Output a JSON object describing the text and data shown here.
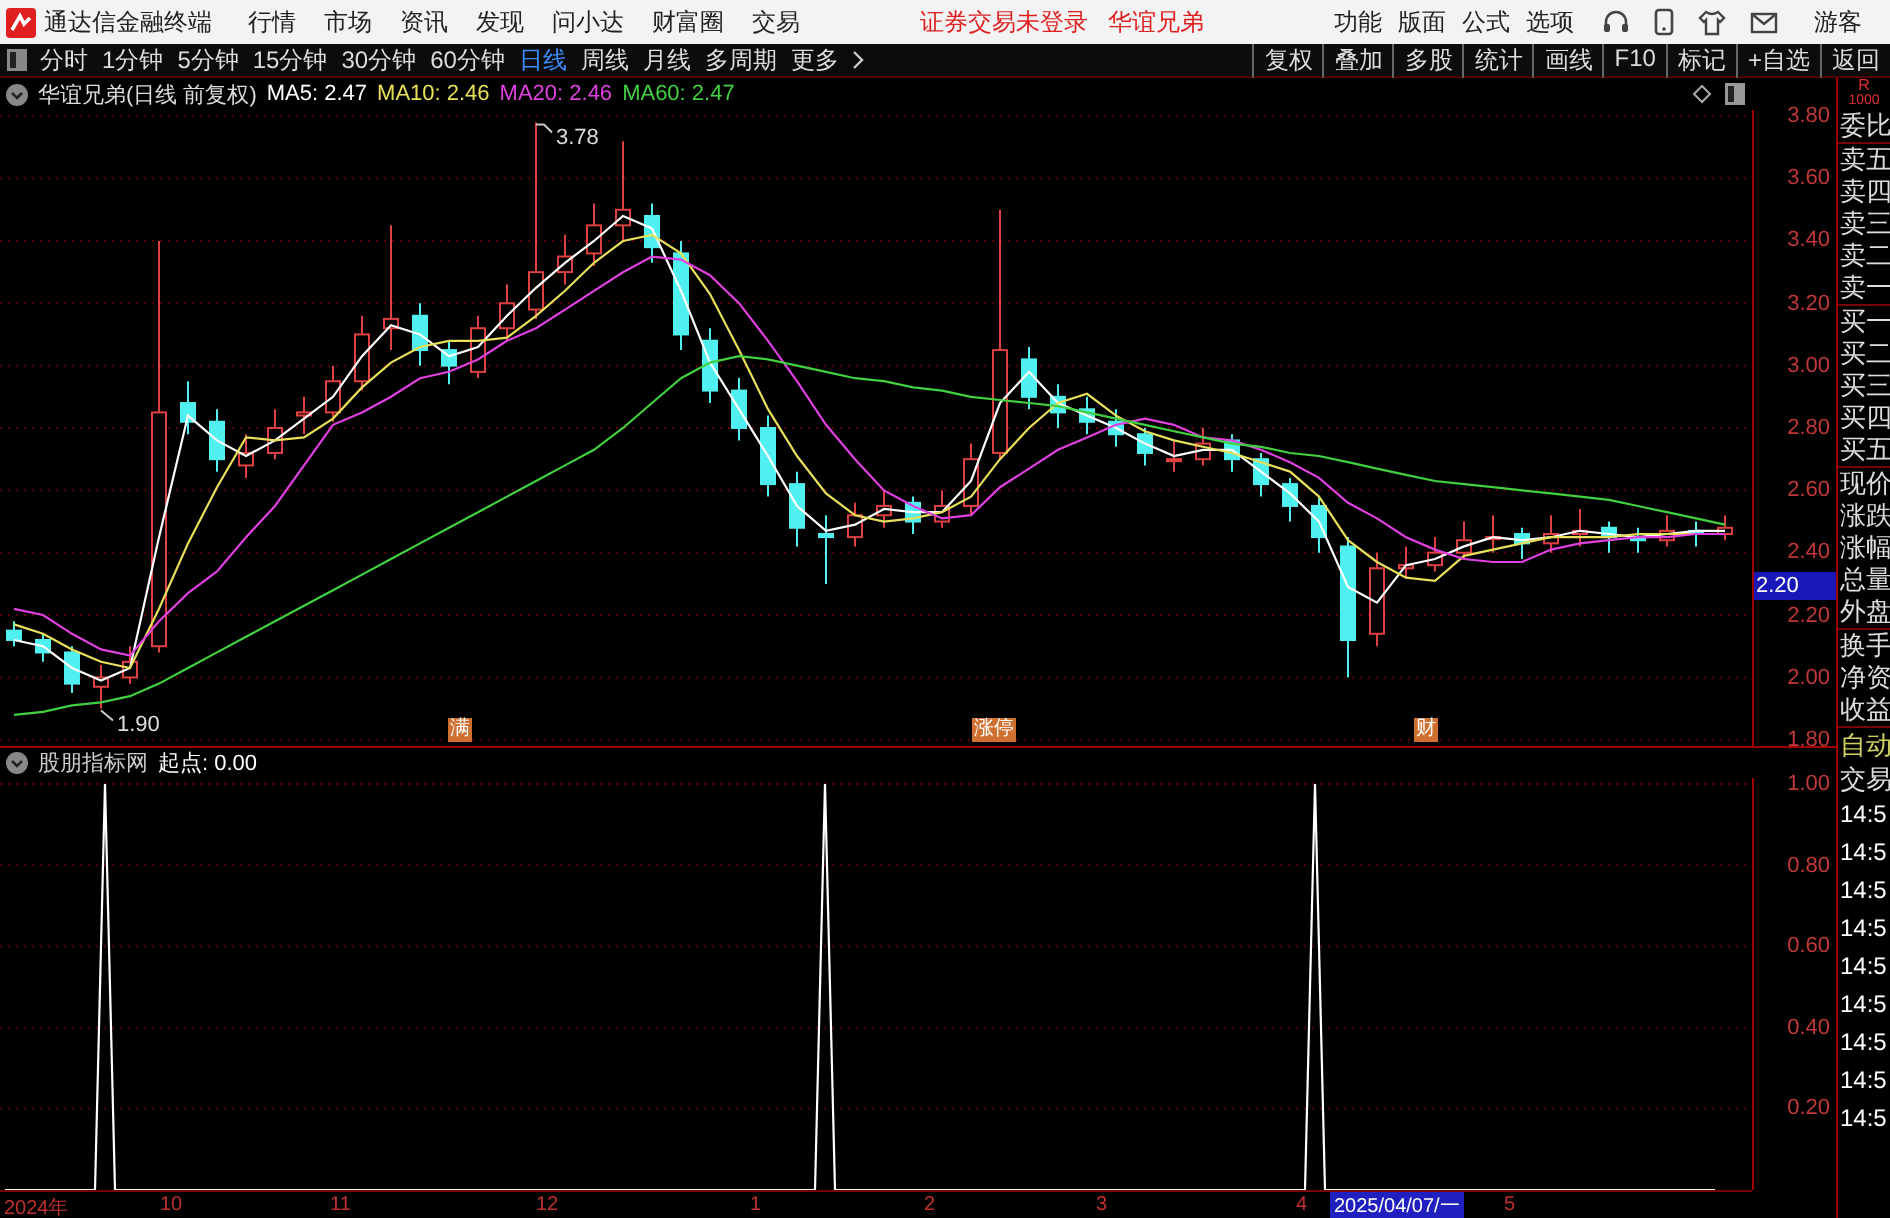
{
  "app": {
    "title": "通达信金融终端"
  },
  "menu": [
    "行情",
    "市场",
    "资讯",
    "发现",
    "问小达",
    "财富圈",
    "交易"
  ],
  "notices": [
    "证券交易未登录",
    "华谊兄弟"
  ],
  "top_actions": [
    "功能",
    "版面",
    "公式",
    "选项"
  ],
  "user": "游客",
  "period_tabs": [
    {
      "label": "分时",
      "selected": false
    },
    {
      "label": "1分钟",
      "selected": false
    },
    {
      "label": "5分钟",
      "selected": false
    },
    {
      "label": "15分钟",
      "selected": false
    },
    {
      "label": "30分钟",
      "selected": false
    },
    {
      "label": "60分钟",
      "selected": false
    },
    {
      "label": "日线",
      "selected": true
    },
    {
      "label": "周线",
      "selected": false
    },
    {
      "label": "月线",
      "selected": false
    },
    {
      "label": "多周期",
      "selected": false
    },
    {
      "label": "更多",
      "selected": false
    }
  ],
  "tools": [
    "复权",
    "叠加",
    "多股",
    "统计",
    "画线",
    "F10",
    "标记",
    "+自选",
    "返回"
  ],
  "chart_header": {
    "title": "华谊兄弟(日线 前复权)",
    "ma_labels": [
      "MA5: 2.47",
      "MA10: 2.46",
      "MA20: 2.46",
      "MA60: 2.47"
    ]
  },
  "price_chart": {
    "chart_data": {
      "type": "candlestick",
      "grid": true,
      "ylim": [
        1.78,
        3.82
      ],
      "yticks": [
        {
          "value": 3.8,
          "label": "3.80"
        },
        {
          "value": 3.6,
          "label": "3.60"
        },
        {
          "value": 3.4,
          "label": "3.40"
        },
        {
          "value": 3.2,
          "label": "3.20"
        },
        {
          "value": 3.0,
          "label": "3.00"
        },
        {
          "value": 2.8,
          "label": "2.80"
        },
        {
          "value": 2.6,
          "label": "2.60"
        },
        {
          "value": 2.4,
          "label": "2.40"
        },
        {
          "value": 2.2,
          "label": "2.20"
        },
        {
          "value": 2.0,
          "label": "2.00"
        },
        {
          "value": 1.8,
          "label": "1.80"
        }
      ],
      "ohlc": [
        [
          2.15,
          2.18,
          2.1,
          2.12
        ],
        [
          2.12,
          2.14,
          2.05,
          2.08
        ],
        [
          2.08,
          2.1,
          1.95,
          1.98
        ],
        [
          1.97,
          2.04,
          1.9,
          2.0
        ],
        [
          2.0,
          2.1,
          1.98,
          2.05
        ],
        [
          2.1,
          3.4,
          2.08,
          2.85
        ],
        [
          2.88,
          2.95,
          2.78,
          2.82
        ],
        [
          2.82,
          2.86,
          2.66,
          2.7
        ],
        [
          2.68,
          2.78,
          2.64,
          2.72
        ],
        [
          2.72,
          2.86,
          2.7,
          2.8
        ],
        [
          2.84,
          2.9,
          2.78,
          2.85
        ],
        [
          2.85,
          3.0,
          2.82,
          2.95
        ],
        [
          2.95,
          3.16,
          2.92,
          3.1
        ],
        [
          3.12,
          3.45,
          3.05,
          3.15
        ],
        [
          3.16,
          3.2,
          3.0,
          3.05
        ],
        [
          3.05,
          3.08,
          2.94,
          3.0
        ],
        [
          2.98,
          3.16,
          2.96,
          3.12
        ],
        [
          3.12,
          3.26,
          3.08,
          3.2
        ],
        [
          3.18,
          3.78,
          3.15,
          3.3
        ],
        [
          3.3,
          3.42,
          3.26,
          3.35
        ],
        [
          3.36,
          3.52,
          3.32,
          3.45
        ],
        [
          3.45,
          3.72,
          3.4,
          3.5
        ],
        [
          3.48,
          3.52,
          3.33,
          3.38
        ],
        [
          3.36,
          3.4,
          3.05,
          3.1
        ],
        [
          3.08,
          3.12,
          2.88,
          2.92
        ],
        [
          2.92,
          2.96,
          2.76,
          2.8
        ],
        [
          2.8,
          2.84,
          2.58,
          2.62
        ],
        [
          2.62,
          2.66,
          2.42,
          2.48
        ],
        [
          2.46,
          2.52,
          2.3,
          2.45
        ],
        [
          2.45,
          2.56,
          2.42,
          2.52
        ],
        [
          2.52,
          2.6,
          2.48,
          2.55
        ],
        [
          2.56,
          2.58,
          2.46,
          2.5
        ],
        [
          2.5,
          2.6,
          2.48,
          2.55
        ],
        [
          2.55,
          2.75,
          2.52,
          2.7
        ],
        [
          2.72,
          3.5,
          2.7,
          3.05
        ],
        [
          3.02,
          3.06,
          2.86,
          2.9
        ],
        [
          2.9,
          2.94,
          2.8,
          2.85
        ],
        [
          2.86,
          2.9,
          2.78,
          2.82
        ],
        [
          2.82,
          2.86,
          2.74,
          2.78
        ],
        [
          2.78,
          2.8,
          2.68,
          2.72
        ],
        [
          2.7,
          2.76,
          2.66,
          2.7
        ],
        [
          2.7,
          2.8,
          2.68,
          2.75
        ],
        [
          2.76,
          2.78,
          2.66,
          2.7
        ],
        [
          2.7,
          2.72,
          2.58,
          2.62
        ],
        [
          2.62,
          2.64,
          2.5,
          2.55
        ],
        [
          2.55,
          2.58,
          2.4,
          2.45
        ],
        [
          2.42,
          2.45,
          2.0,
          2.12
        ],
        [
          2.14,
          2.4,
          2.1,
          2.35
        ],
        [
          2.35,
          2.42,
          2.32,
          2.36
        ],
        [
          2.36,
          2.45,
          2.34,
          2.4
        ],
        [
          2.4,
          2.5,
          2.38,
          2.44
        ],
        [
          2.45,
          2.52,
          2.4,
          2.45
        ],
        [
          2.46,
          2.48,
          2.38,
          2.43
        ],
        [
          2.43,
          2.52,
          2.4,
          2.46
        ],
        [
          2.46,
          2.54,
          2.42,
          2.47
        ],
        [
          2.48,
          2.5,
          2.4,
          2.45
        ],
        [
          2.45,
          2.48,
          2.4,
          2.44
        ],
        [
          2.44,
          2.52,
          2.42,
          2.47
        ],
        [
          2.47,
          2.5,
          2.42,
          2.46
        ],
        [
          2.46,
          2.52,
          2.44,
          2.48
        ]
      ],
      "series": [
        {
          "type": "line",
          "color": "#ffffff",
          "values": [
            2.12,
            2.1,
            2.03,
            1.99,
            2.03,
            2.45,
            2.84,
            2.76,
            2.71,
            2.76,
            2.83,
            2.9,
            3.03,
            3.13,
            3.1,
            3.03,
            3.06,
            3.16,
            3.25,
            3.33,
            3.4,
            3.48,
            3.44,
            3.24,
            3.01,
            2.86,
            2.71,
            2.55,
            2.47,
            2.49,
            2.54,
            2.53,
            2.53,
            2.63,
            2.88,
            2.98,
            2.88,
            2.84,
            2.8,
            2.75,
            2.71,
            2.73,
            2.73,
            2.66,
            2.59,
            2.5,
            2.29,
            2.24,
            2.36,
            2.38,
            2.42,
            2.45,
            2.44,
            2.45,
            2.47,
            2.46,
            2.45,
            2.46,
            2.47,
            2.47
          ]
        },
        {
          "type": "line",
          "color": "#e8e05a",
          "values": [
            2.17,
            2.14,
            2.09,
            2.05,
            2.03,
            2.22,
            2.43,
            2.61,
            2.77,
            2.76,
            2.77,
            2.83,
            2.93,
            3.01,
            3.06,
            3.08,
            3.08,
            3.09,
            3.16,
            3.24,
            3.33,
            3.4,
            3.42,
            3.36,
            3.23,
            3.05,
            2.86,
            2.71,
            2.59,
            2.52,
            2.5,
            2.51,
            2.53,
            2.58,
            2.7,
            2.8,
            2.88,
            2.91,
            2.84,
            2.79,
            2.76,
            2.74,
            2.72,
            2.69,
            2.66,
            2.58,
            2.44,
            2.37,
            2.32,
            2.31,
            2.39,
            2.41,
            2.43,
            2.45,
            2.45,
            2.45,
            2.46,
            2.46,
            2.46,
            2.46
          ]
        },
        {
          "type": "line",
          "color": "#e040e0",
          "values": [
            2.22,
            2.2,
            2.14,
            2.09,
            2.07,
            2.18,
            2.27,
            2.34,
            2.45,
            2.55,
            2.68,
            2.81,
            2.85,
            2.9,
            2.96,
            2.98,
            3.02,
            3.08,
            3.12,
            3.18,
            3.24,
            3.3,
            3.35,
            3.34,
            3.29,
            3.2,
            3.08,
            2.95,
            2.81,
            2.7,
            2.6,
            2.55,
            2.51,
            2.52,
            2.61,
            2.67,
            2.73,
            2.77,
            2.81,
            2.83,
            2.81,
            2.77,
            2.76,
            2.73,
            2.69,
            2.64,
            2.56,
            2.51,
            2.45,
            2.41,
            2.38,
            2.37,
            2.37,
            2.41,
            2.43,
            2.44,
            2.45,
            2.45,
            2.46,
            2.46
          ]
        },
        {
          "type": "line",
          "color": "#40d040",
          "values": [
            1.88,
            1.89,
            1.91,
            1.92,
            1.94,
            1.98,
            2.03,
            2.08,
            2.13,
            2.18,
            2.23,
            2.28,
            2.33,
            2.38,
            2.43,
            2.48,
            2.53,
            2.58,
            2.63,
            2.68,
            2.73,
            2.8,
            2.88,
            2.96,
            3.01,
            3.03,
            3.02,
            3.0,
            2.98,
            2.96,
            2.95,
            2.93,
            2.92,
            2.9,
            2.89,
            2.88,
            2.87,
            2.85,
            2.83,
            2.81,
            2.79,
            2.77,
            2.75,
            2.74,
            2.72,
            2.71,
            2.69,
            2.67,
            2.65,
            2.63,
            2.62,
            2.61,
            2.6,
            2.59,
            2.58,
            2.57,
            2.55,
            2.53,
            2.51,
            2.49
          ]
        }
      ]
    }
  },
  "price_cursor": "2.20",
  "high_label": "3.78",
  "low_label": "1.90",
  "event_markers": [
    "满",
    "涨停",
    "财"
  ],
  "indicator": {
    "name": "股朋指标网",
    "readout": "起点: 0.00",
    "chart_data": {
      "type": "line",
      "grid": true,
      "ylim": [
        0,
        1.015
      ],
      "yticks": [
        {
          "value": 0.2,
          "label": "0.20"
        },
        {
          "value": 0.4,
          "label": "0.40"
        },
        {
          "value": 0.6,
          "label": "0.60"
        },
        {
          "value": 0.8,
          "label": "0.80"
        },
        {
          "value": 1,
          "label": "1.00"
        }
      ],
      "series": [
        {
          "color": "#ffffff",
          "values": [
            0,
            0,
            0,
            0,
            0,
            0,
            0,
            0,
            0,
            0,
            1,
            0,
            0,
            0,
            0,
            0,
            0,
            0,
            0,
            0,
            0,
            0,
            0,
            0,
            0,
            0,
            0,
            0,
            0,
            0,
            0,
            0,
            0,
            0,
            0,
            0,
            0,
            0,
            0,
            0,
            0,
            0,
            0,
            0,
            0,
            0,
            0,
            0,
            0,
            0,
            0,
            0,
            0,
            0,
            0,
            0,
            0,
            0,
            0,
            0,
            0,
            0,
            0,
            0,
            0,
            0,
            0,
            0,
            0,
            0,
            0,
            0,
            0,
            0,
            0,
            0,
            0,
            0,
            0,
            0,
            0,
            0,
            1,
            0,
            0,
            0,
            0,
            0,
            0,
            0,
            0,
            0,
            0,
            0,
            0,
            0,
            0,
            0,
            0,
            0,
            0,
            0,
            0,
            0,
            0,
            0,
            0,
            0,
            0,
            0,
            0,
            0,
            0,
            0,
            0,
            0,
            0,
            0,
            0,
            0,
            0,
            0,
            0,
            0,
            0,
            0,
            0,
            0,
            0,
            0,
            0,
            1,
            0,
            0,
            0,
            0,
            0,
            0,
            0,
            0,
            0,
            0,
            0,
            0,
            0,
            0,
            0,
            0,
            0,
            0,
            0,
            0,
            0,
            0,
            0,
            0,
            0,
            0,
            0,
            0,
            0,
            0,
            0,
            0,
            0,
            0,
            0,
            0,
            0,
            0,
            0,
            0
          ]
        }
      ]
    }
  },
  "date_axis": [
    "2024年",
    "10",
    "11",
    "12",
    "1",
    "2",
    "3",
    "4",
    "5"
  ],
  "date_cursor": "2025/04/07/一",
  "quote_panel": {
    "corner": [
      "R",
      "1000"
    ],
    "labels": [
      "委比",
      "卖五",
      "卖四",
      "卖三",
      "卖二",
      "卖一",
      "买一",
      "买二",
      "买三",
      "买四",
      "买五",
      "现价",
      "涨跌",
      "涨幅",
      "总量",
      "外盘",
      "换手",
      "净资",
      "收益"
    ],
    "mode": "自动",
    "trades_title": "交易",
    "trade_times": [
      "14:5",
      "14:5",
      "14:5",
      "14:5",
      "14:5",
      "14:5",
      "14:5",
      "14:5",
      "14:5"
    ]
  }
}
